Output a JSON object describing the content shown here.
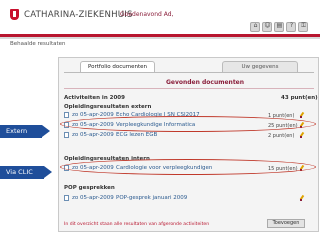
{
  "header": {
    "brand": "CATHARINA-ZIEKENHUIS",
    "greeting": "Goedenavond Ad,",
    "nav_icons": [
      "home-icon",
      "people-icon",
      "document-icon",
      "help-icon",
      "lock-icon"
    ]
  },
  "breadcrumb": "Behaalde resultaten",
  "tabs": [
    {
      "label": "Portfolio documenten",
      "active": true
    },
    {
      "label": "Uw gegevens",
      "active": false
    }
  ],
  "section_title": "Gevonden documenten",
  "activities": {
    "heading": "Activiteiten in 2009",
    "total": "43 punt(en)"
  },
  "groups": [
    {
      "title": "Opleidingsresultaten extern",
      "rows": [
        {
          "date": "zo 05-apr-2009",
          "title": "Echo Cardiologie I SN CSI2017",
          "points": "1 punt(en)"
        },
        {
          "date": "zo 05-apr-2009",
          "title": "Verpleegkundige Informatica",
          "points": "25 punt(en)"
        },
        {
          "date": "zo 05-apr-2009",
          "title": "ECG lezen EGB",
          "points": "2 punt(en)"
        }
      ]
    },
    {
      "title": "Opleidingsresultaten intern",
      "rows": [
        {
          "date": "zo 05-apr-2009",
          "title": "Cardiologie voor verpleegkundigen",
          "points": "15 punt(en)"
        }
      ]
    },
    {
      "title": "POP gesprekken",
      "rows": [
        {
          "date": "zo 05-apr-2009",
          "title": "POP-gesprek januari 2009",
          "points": ""
        }
      ]
    }
  ],
  "callouts": {
    "extern": "Extern",
    "via_clic": "Via CLIC"
  },
  "footer": {
    "note": "In dit overzicht staan alle resultaten van afgeronde activiteiten",
    "button": "Toevoegen"
  },
  "colors": {
    "brand_red": "#b8162f",
    "callout_blue": "#1f4e9a",
    "highlight_red": "#c0392b"
  }
}
